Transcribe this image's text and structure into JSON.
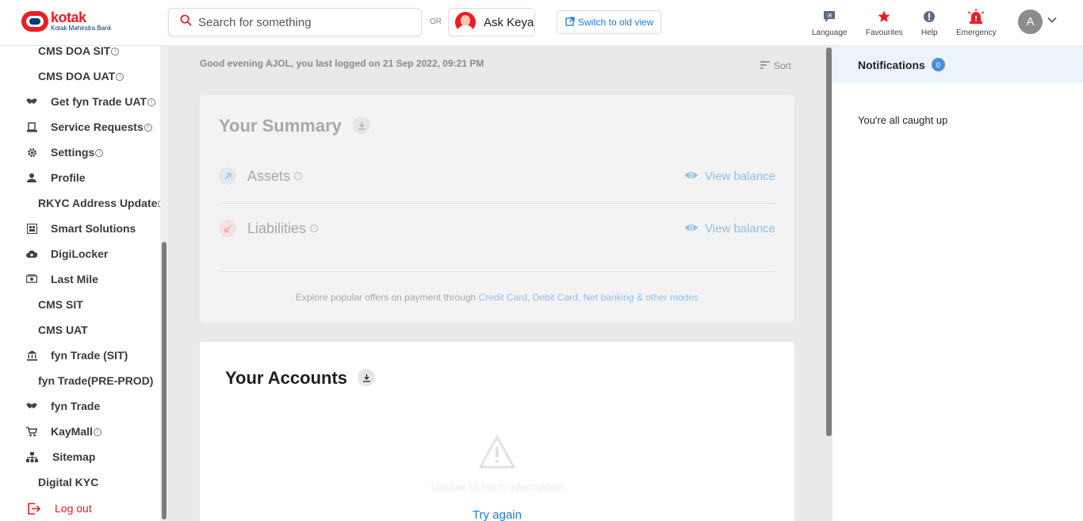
{
  "header": {
    "brand": "kotak",
    "brand_sub": "Kotak Mahindra Bank",
    "search_placeholder": "Search for something",
    "or_label": "OR",
    "ask_keya": "Ask Keya",
    "switch_view": "Switch to old view",
    "icons": [
      {
        "name": "language-icon",
        "label": "Language",
        "glyph": "अ"
      },
      {
        "name": "favourites-icon",
        "label": "Favourites",
        "glyph": "★"
      },
      {
        "name": "help-icon",
        "label": "Help",
        "glyph": "!"
      },
      {
        "name": "emergency-icon",
        "label": "Emergency",
        "glyph": "!"
      }
    ],
    "profile_initial": "A"
  },
  "sidebar": {
    "items": [
      {
        "label": "CMS DOA SIT",
        "icon": null,
        "info": true
      },
      {
        "label": "CMS DOA UAT",
        "icon": null,
        "info": true
      },
      {
        "label": "Get fyn Trade UAT",
        "icon": "handshake-icon",
        "info": true
      },
      {
        "label": "Service Requests",
        "icon": "service-request-icon",
        "info": true
      },
      {
        "label": "Settings",
        "icon": "gear-icon",
        "info": true
      },
      {
        "label": "Profile",
        "icon": "person-icon",
        "info": false
      },
      {
        "label": "RKYC Address Update",
        "icon": null,
        "info": true
      },
      {
        "label": "Smart Solutions",
        "icon": "smart-solutions-icon",
        "info": false
      },
      {
        "label": "DigiLocker",
        "icon": "cloud-lock-icon",
        "info": false
      },
      {
        "label": "Last Mile",
        "icon": "cash-icon",
        "info": false
      },
      {
        "label": "CMS SIT",
        "icon": null,
        "info": false
      },
      {
        "label": "CMS UAT",
        "icon": null,
        "info": false
      },
      {
        "label": "fyn Trade (SIT)",
        "icon": "bank-icon",
        "info": false
      },
      {
        "label": "fyn Trade(PRE-PROD)",
        "icon": null,
        "info": false
      },
      {
        "label": "fyn Trade",
        "icon": "handshake-icon",
        "info": false
      },
      {
        "label": "KayMall",
        "icon": "cart-icon",
        "info": true
      },
      {
        "label": "Sitemap",
        "icon": "sitemap-icon",
        "info": false
      },
      {
        "label": "Digital KYC",
        "icon": null,
        "info": false
      }
    ],
    "logout": "Log out"
  },
  "main": {
    "greeting": "Good evening AJOL, you last logged on 21 Sep 2022, 09:21 PM",
    "sort": "Sort",
    "summary": {
      "title": "Your Summary",
      "assets": "Assets",
      "liabilities": "Liabilities",
      "view_balance": "View balance",
      "offers_text": "Explore popular offers on payment through ",
      "offers_link": "Credit Card, Debit Card, Net banking & other modes"
    },
    "accounts": {
      "title": "Your Accounts",
      "error": "Unable to fetch information",
      "retry": "Try again"
    }
  },
  "notifications": {
    "title": "Notifications",
    "count": "0",
    "empty": "You're all caught up"
  },
  "colors": {
    "brand_red": "#ed1c24",
    "brand_blue": "#003874",
    "link_blue": "#1d7cd6"
  }
}
